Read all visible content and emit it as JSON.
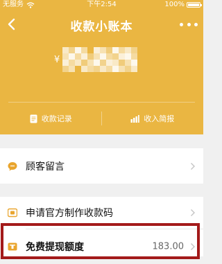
{
  "status_bar": {
    "carrier": "无服务",
    "time": "下午2:54",
    "battery": "100%",
    "battery_level": 1.0
  },
  "nav": {
    "title": "收款小账本",
    "back_icon": "chevron-left-icon",
    "more_icon": "more-dots-icon"
  },
  "balance": {
    "currency_symbol": "¥"
  },
  "actions": [
    {
      "label": "收款记录",
      "icon": "document-icon"
    },
    {
      "label": "收入简报",
      "icon": "bar-chart-icon"
    }
  ],
  "menu": [
    {
      "label": "顾客留言",
      "icon": "message-icon"
    },
    {
      "label": "申请官方制作收款码",
      "icon": "qr-card-icon"
    },
    {
      "label": "免费提现额度",
      "icon": "quota-icon",
      "value": "183.00"
    }
  ],
  "colors": {
    "header": "#eab642",
    "accent_icon": "#e9a52e",
    "highlight_border": "#a31a1a"
  }
}
